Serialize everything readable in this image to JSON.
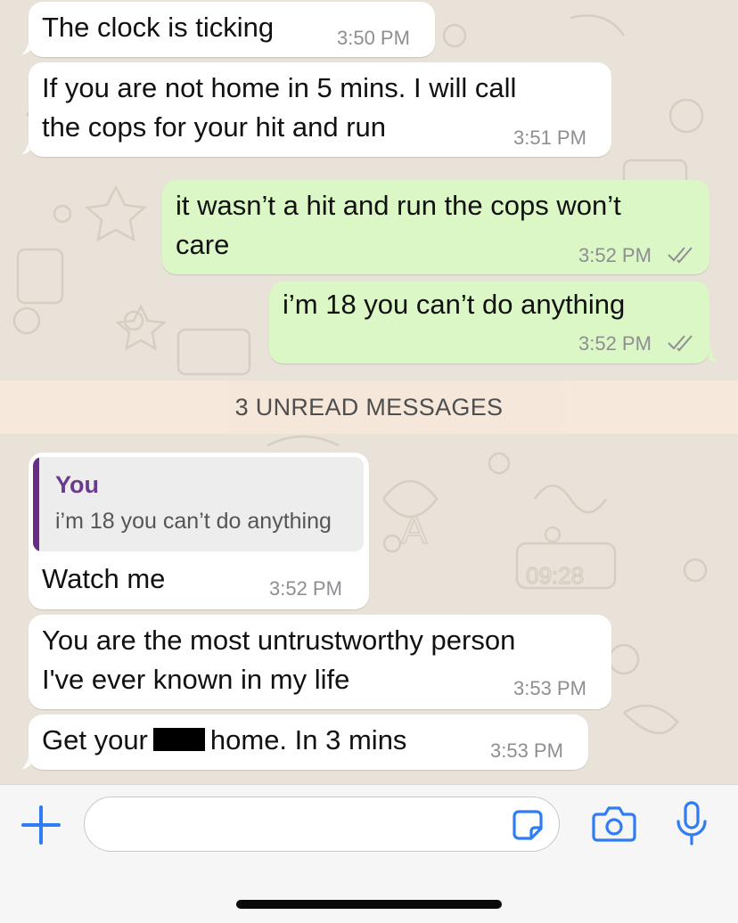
{
  "messages": [
    {
      "text": "The clock is ticking",
      "time": "3:50 PM",
      "direction": "incoming"
    },
    {
      "text_lines": [
        "If you are not home in 5 mins. I will call",
        "the cops for your hit and run"
      ],
      "time": "3:51 PM",
      "direction": "incoming"
    },
    {
      "text_lines": [
        "it wasn’t a hit and run the cops won’t",
        "care"
      ],
      "time": "3:52 PM",
      "direction": "outgoing",
      "status": "read"
    },
    {
      "text": "i’m 18 you can’t do anything",
      "time": "3:52 PM",
      "direction": "outgoing",
      "status": "read"
    },
    {
      "reply_to": {
        "author": "You",
        "text": "i’m 18 you can’t do anything"
      },
      "text": "Watch me",
      "time": "3:52 PM",
      "direction": "incoming"
    },
    {
      "text_lines": [
        "You are the most untrustworthy person",
        "I've ever known in my life"
      ],
      "time": "3:53 PM",
      "direction": "incoming"
    },
    {
      "text_before": "Get your",
      "text_after": "home. In 3 mins",
      "time": "3:53 PM",
      "direction": "incoming",
      "redacted": true
    }
  ],
  "unread_banner": "3 UNREAD MESSAGES",
  "composer": {
    "value": "",
    "placeholder": ""
  },
  "icons": {
    "attach": "plus-icon",
    "sticker": "sticker-icon",
    "camera": "camera-icon",
    "microphone": "microphone-icon",
    "read_receipt": "double-check-icon"
  },
  "colors": {
    "incoming_bubble": "#ffffff",
    "outgoing_bubble": "#dcf7c6",
    "accent": "#2f7cf6",
    "read_tick": "#8e8e93",
    "quote_bar": "#6a2b88",
    "unread_banner": "#f6e9dc"
  }
}
